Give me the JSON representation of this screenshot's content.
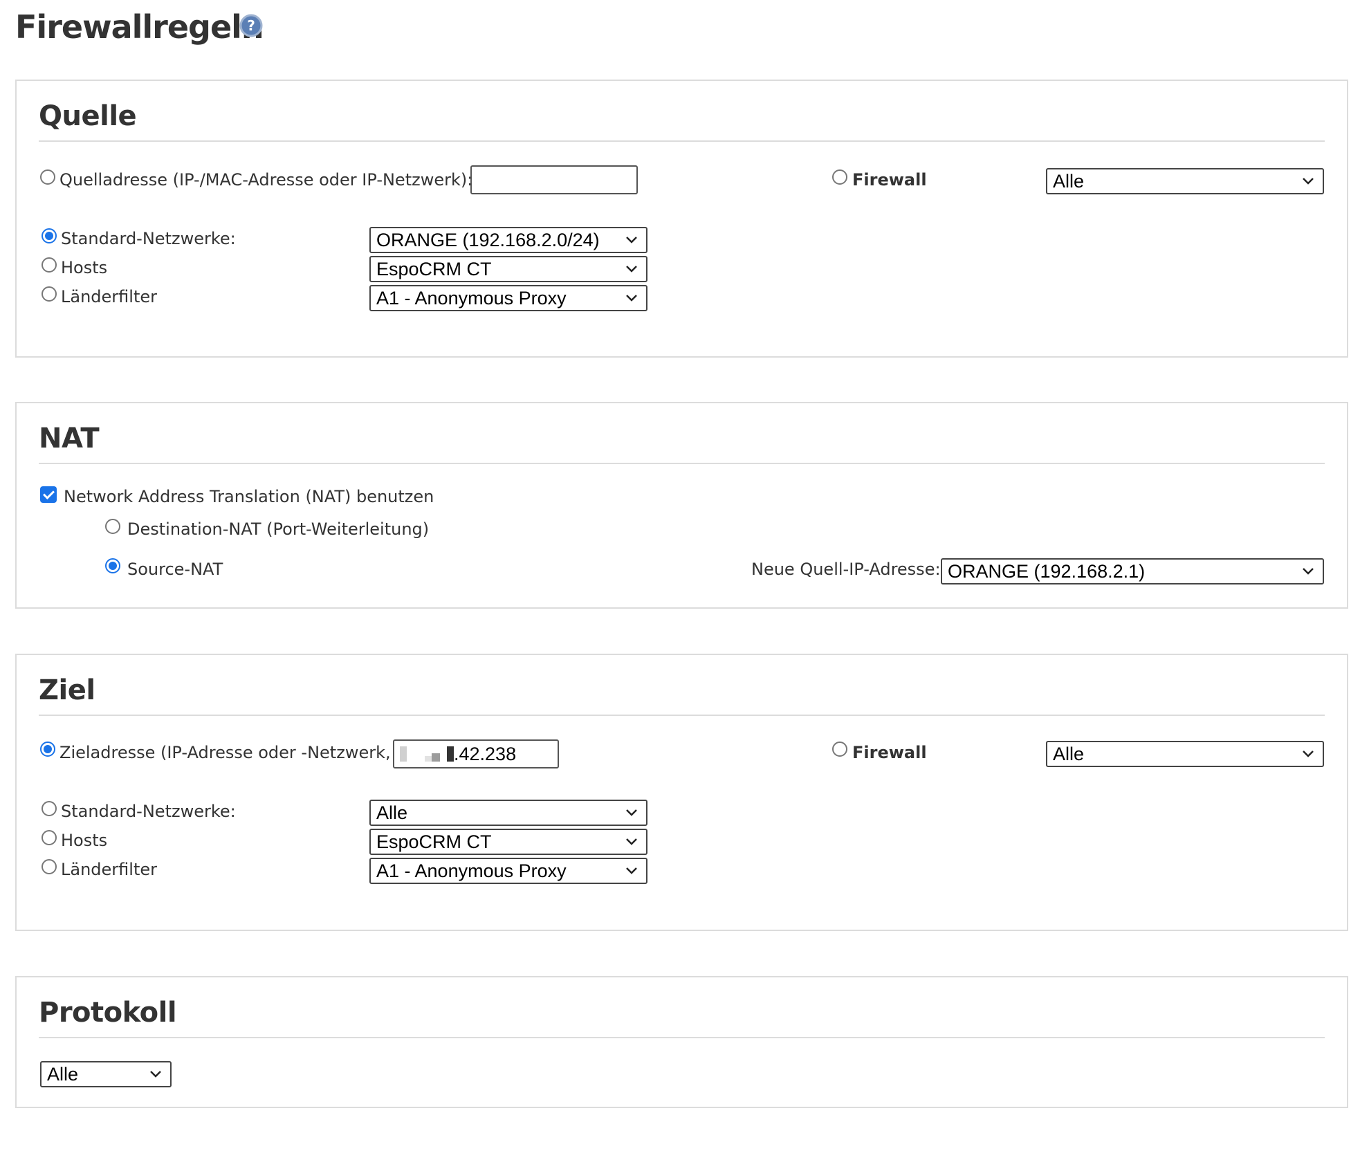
{
  "page": {
    "title": "Firewallregeln"
  },
  "source": {
    "title": "Quelle",
    "address_label": "Quelladresse (IP-/MAC-Adresse oder IP-Netzwerk):",
    "address_value": "",
    "firewall_label": "Firewall",
    "firewall_select": "Alle",
    "standard_label": "Standard-Netzwerke:",
    "standard_select": "ORANGE (192.168.2.0/24)",
    "hosts_label": "Hosts",
    "hosts_select": "EspoCRM CT",
    "country_label": "Länderfilter",
    "country_select": "A1 - Anonymous Proxy",
    "selected": "standard"
  },
  "nat": {
    "title": "NAT",
    "use_label": "Network Address Translation (NAT) benutzen",
    "use_checked": true,
    "dnat_label": "Destination-NAT (Port-Weiterleitung)",
    "snat_label": "Source-NAT",
    "selected": "snat",
    "new_source_label": "Neue Quell-IP-Adresse:",
    "new_source_select": "ORANGE (192.168.2.1)"
  },
  "destination": {
    "title": "Ziel",
    "address_label": "Zieladresse (IP-Adresse oder -Netzwerk,",
    "address_value": ".42.238",
    "firewall_label": "Firewall",
    "firewall_select": "Alle",
    "standard_label": "Standard-Netzwerke:",
    "standard_select": "Alle",
    "hosts_label": "Hosts",
    "hosts_select": "EspoCRM CT",
    "country_label": "Länderfilter",
    "country_select": "A1 - Anonymous Proxy",
    "selected": "address"
  },
  "protocol": {
    "title": "Protokoll",
    "select": "Alle"
  },
  "colors": {
    "accent": "#1a73e8",
    "border": "#dcdcdc",
    "help_icon": "#5b7fb5"
  },
  "icons": {
    "help": "help-icon",
    "dropdown": "chevron-down-icon"
  }
}
